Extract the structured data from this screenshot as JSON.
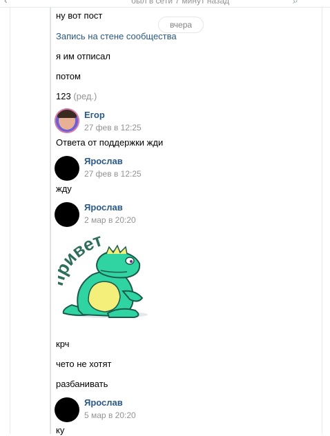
{
  "header": {
    "status_text": "был в сети 7 минут назад"
  },
  "date_separator": "вчера",
  "messages_top": [
    {
      "text": "ну вот пост"
    },
    {
      "text": "Запись на стене сообщества"
    },
    {
      "text": "я им отписал"
    },
    {
      "text": "потом"
    },
    {
      "text": "123",
      "edited": "(ред.)"
    }
  ],
  "groups": [
    {
      "author": "Егор",
      "time": "27 фев в 12:25",
      "messages": [
        "Ответа от поддержки жди"
      ]
    },
    {
      "author": "Ярослав",
      "time": "27 фев в 12:25",
      "messages": [
        "жду"
      ]
    },
    {
      "author": "Ярослав",
      "time": "2 мар в 20:20",
      "sticker_text": "привет",
      "messages": [
        "крч",
        "чето не хотят",
        "разбанивать"
      ]
    },
    {
      "author": "Ярослав",
      "time": "5 мар в 20:20",
      "messages": [
        "ку"
      ]
    }
  ],
  "colors": {
    "link": "#2a5885",
    "meta": "#939393",
    "sticker_body": "#2fd4a2"
  }
}
